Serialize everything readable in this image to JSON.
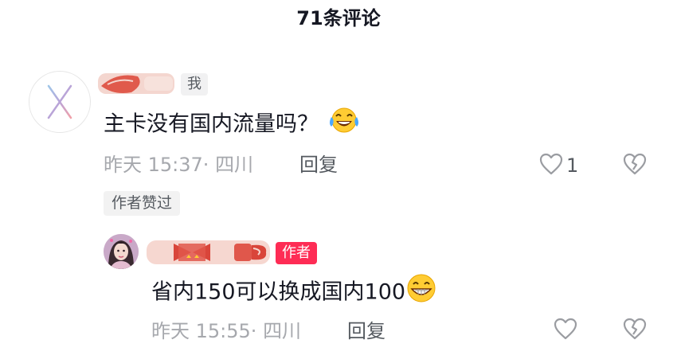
{
  "header": {
    "title": "71条评论"
  },
  "comments": [
    {
      "tag": "我",
      "text": "主卡没有国内流量吗？",
      "emoji": "laugh-cry-icon",
      "time": "昨天 15:37",
      "location": "四川",
      "reply_label": "回复",
      "likes": "1",
      "author_liked": "作者赞过"
    }
  ],
  "reply": {
    "tag": "作者",
    "text": "省内150可以换成国内100",
    "emoji": "grin-icon",
    "time": "昨天 15:55",
    "location": "四川",
    "reply_label": "回复"
  },
  "colors": {
    "accent": "#fe2c55",
    "text_primary": "#161823",
    "text_secondary": "#a6a8ad",
    "tag_bg": "#f1f1f2"
  }
}
